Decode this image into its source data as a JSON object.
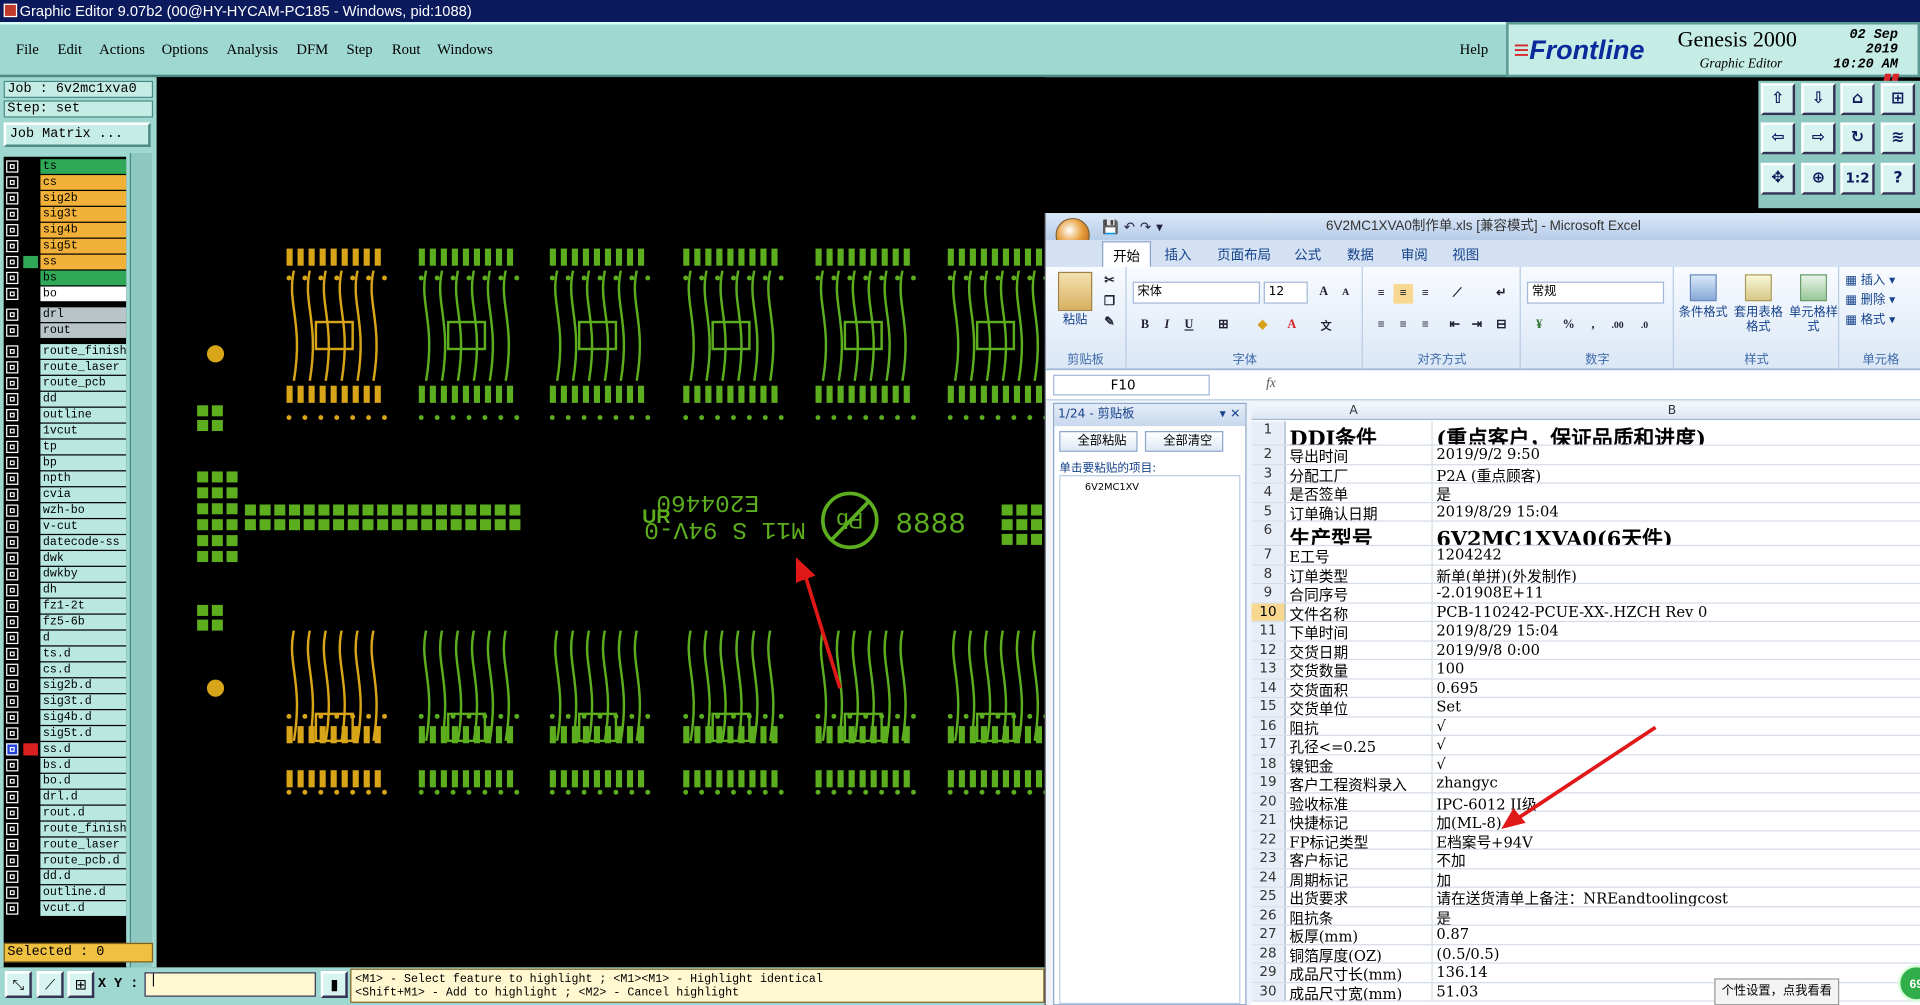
{
  "genesis": {
    "window_title": "Graphic Editor 9.07b2 (00@HY-HYCAM-PC185 - Windows, pid:1088)",
    "menu": [
      "File",
      "Edit",
      "Actions",
      "Options",
      "Analysis",
      "DFM",
      "Step",
      "Rout",
      "Windows"
    ],
    "help": "Help",
    "brand_name": "Frontline",
    "product": "Genesis 2000",
    "subtitle": "Graphic Editor",
    "date": "02 Sep 2019",
    "time": "10:20 AM",
    "job": "Job : 6v2mc1xva0",
    "step": "Step: set",
    "job_matrix": "Job Matrix ...",
    "layers": [
      {
        "name": "ts",
        "color": "#2fa858"
      },
      {
        "name": "cs",
        "color": "#f2b23a"
      },
      {
        "name": "sig2b",
        "color": "#f2b23a"
      },
      {
        "name": "sig3t",
        "color": "#f2b23a"
      },
      {
        "name": "sig4b",
        "color": "#f2b23a"
      },
      {
        "name": "sig5t",
        "color": "#f2b23a"
      },
      {
        "name": "ss",
        "color": "#f2b23a"
      },
      {
        "name": "bs",
        "color": "#2fa858"
      },
      {
        "name": "bo",
        "color": "#ffffff"
      },
      {
        "name": "drl",
        "color": "#b8c4c8"
      },
      {
        "name": "rout",
        "color": "#b8c4c8"
      },
      {
        "name": "route_finish",
        "color": "#b8e8e0"
      },
      {
        "name": "route_laser",
        "color": "#b8e8e0"
      },
      {
        "name": "route_pcb",
        "color": "#b8e8e0"
      },
      {
        "name": "dd",
        "color": "#b8e8e0"
      },
      {
        "name": "outline",
        "color": "#b8e8e0"
      },
      {
        "name": "1vcut",
        "color": "#b8e8e0"
      },
      {
        "name": "tp",
        "color": "#b8e8e0"
      },
      {
        "name": "bp",
        "color": "#b8e8e0"
      },
      {
        "name": "npth",
        "color": "#b8e8e0"
      },
      {
        "name": "cvia",
        "color": "#b8e8e0"
      },
      {
        "name": "wzh-bo",
        "color": "#b8e8e0"
      },
      {
        "name": "v-cut",
        "color": "#b8e8e0"
      },
      {
        "name": "datecode-ss",
        "color": "#b8e8e0"
      },
      {
        "name": "dwk",
        "color": "#b8e8e0"
      },
      {
        "name": "dwkby",
        "color": "#b8e8e0"
      },
      {
        "name": "dh",
        "color": "#b8e8e0"
      },
      {
        "name": "fz1-2t",
        "color": "#b8e8e0"
      },
      {
        "name": "fz5-6b",
        "color": "#b8e8e0"
      },
      {
        "name": "d",
        "color": "#b8e8e0"
      },
      {
        "name": "ts.d",
        "color": "#b8e8e0"
      },
      {
        "name": "cs.d",
        "color": "#b8e8e0"
      },
      {
        "name": "sig2b.d",
        "color": "#b8e8e0"
      },
      {
        "name": "sig3t.d",
        "color": "#b8e8e0"
      },
      {
        "name": "sig4b.d",
        "color": "#b8e8e0"
      },
      {
        "name": "sig5t.d",
        "color": "#b8e8e0"
      },
      {
        "name": "ss.d",
        "color": "#b8e8e0"
      },
      {
        "name": "bs.d",
        "color": "#b8e8e0"
      },
      {
        "name": "bo.d",
        "color": "#b8e8e0"
      },
      {
        "name": "drl.d",
        "color": "#b8e8e0"
      },
      {
        "name": "rout.d",
        "color": "#b8e8e0"
      },
      {
        "name": "route_finish",
        "color": "#b8e8e0"
      },
      {
        "name": "route_laser",
        "color": "#b8e8e0"
      },
      {
        "name": "route_pcb.d",
        "color": "#b8e8e0"
      },
      {
        "name": "dd.d",
        "color": "#b8e8e0"
      },
      {
        "name": "outline.d",
        "color": "#b8e8e0"
      },
      {
        "name": "vcut.d",
        "color": "#b8e8e0"
      }
    ],
    "selected": "Selected : 0",
    "xy_label": "X Y :",
    "hint_line1": "<M1> - Select feature to highlight ; <M1><M1> - Highlight identical",
    "hint_line2": "<Shift+M1> - Add to highlight ; <M2> - Cancel highlight",
    "board_text": {
      "code": "E204460",
      "spec": "M11 S 94V-0",
      "ul": "UR",
      "pb": "Pb",
      "digits": "8888"
    },
    "colors": {
      "copper_green": "#5cae1e",
      "copper_yellow": "#d8a418",
      "menu_bg": "#9fd8d0",
      "title_bg": "#0a1a5c"
    }
  },
  "excel": {
    "title": "6V2MC1XVA0制作单.xls [兼容模式] - Microsoft Excel",
    "tabs": [
      "开始",
      "插入",
      "页面布局",
      "公式",
      "数据",
      "审阅",
      "视图"
    ],
    "clipboard_group": "剪贴板",
    "paste": "粘贴",
    "font_group": "字体",
    "font_name": "宋体",
    "font_size": "12",
    "align_group": "对齐方式",
    "number_group": "数字",
    "number_format": "常规",
    "style_group": "样式",
    "cond_format": "条件格式",
    "table_format": "套用表格格式",
    "cell_style": "单元格样式",
    "cells_group": "单元格",
    "insert": "插入",
    "delete": "删除",
    "format": "格式",
    "namebox": "F10",
    "fx": "fx",
    "clip_header": "1/24 - 剪贴板",
    "paste_all": "全部粘贴",
    "clear_all": "全部清空",
    "clip_hint": "单击要粘贴的项目:",
    "clip_item": "6V2MC1XV",
    "col_a": "A",
    "col_b": "B",
    "rows": [
      {
        "n": "1",
        "a": "DDI条件",
        "b": "(重点客户，保证品质和进度)",
        "big": true
      },
      {
        "n": "2",
        "a": "导出时间",
        "b": "2019/9/2 9:50"
      },
      {
        "n": "3",
        "a": "分配工厂",
        "b": "P2A (重点顾客)"
      },
      {
        "n": "4",
        "a": "是否签单",
        "b": "是"
      },
      {
        "n": "5",
        "a": "订单确认日期",
        "b": "2019/8/29 15:04"
      },
      {
        "n": "6",
        "a": "生产型号",
        "b": "6V2MC1XVA0(6天件)",
        "big": true
      },
      {
        "n": "7",
        "a": "E工号",
        "b": "1204242"
      },
      {
        "n": "8",
        "a": "订单类型",
        "b": "新单(单拼)(外发制作)"
      },
      {
        "n": "9",
        "a": "合同序号",
        "b": "-2.01908E+11"
      },
      {
        "n": "10",
        "a": "文件名称",
        "b": "PCB-110242-PCUE-XX-.HZCH Rev 0",
        "sel": true
      },
      {
        "n": "11",
        "a": "下单时间",
        "b": "2019/8/29 15:04"
      },
      {
        "n": "12",
        "a": "交货日期",
        "b": "2019/9/8 0:00"
      },
      {
        "n": "13",
        "a": "交货数量",
        "b": "100"
      },
      {
        "n": "14",
        "a": "交货面积",
        "b": "0.695"
      },
      {
        "n": "15",
        "a": "交货单位",
        "b": "Set"
      },
      {
        "n": "16",
        "a": "阻抗",
        "b": "√"
      },
      {
        "n": "17",
        "a": "孔径<=0.25",
        "b": "√"
      },
      {
        "n": "18",
        "a": "镍钯金",
        "b": "√"
      },
      {
        "n": "19",
        "a": "客户工程资料录入",
        "b": "zhangyc"
      },
      {
        "n": "20",
        "a": "验收标准",
        "b": "IPC-6012 II级"
      },
      {
        "n": "21",
        "a": "快捷标记",
        "b": "加(ML-8)"
      },
      {
        "n": "22",
        "a": "FP标记类型",
        "b": "E档案号+94V"
      },
      {
        "n": "23",
        "a": "客户标记",
        "b": "不加"
      },
      {
        "n": "24",
        "a": "周期标记",
        "b": "加"
      },
      {
        "n": "25",
        "a": "出货要求",
        "b": "请在送货清单上备注：NREandtoolingcost"
      },
      {
        "n": "26",
        "a": "阻抗条",
        "b": "是"
      },
      {
        "n": "27",
        "a": "板厚(mm)",
        "b": "0.87"
      },
      {
        "n": "28",
        "a": "铜箔厚度(OZ)",
        "b": "(0.5/0.5)"
      },
      {
        "n": "29",
        "a": "成品尺寸长(mm)",
        "b": "136.14"
      },
      {
        "n": "30",
        "a": "成品尺寸宽(mm)",
        "b": "51.03"
      }
    ],
    "tooltip": "个性设置，点我看看",
    "badge": "69"
  }
}
